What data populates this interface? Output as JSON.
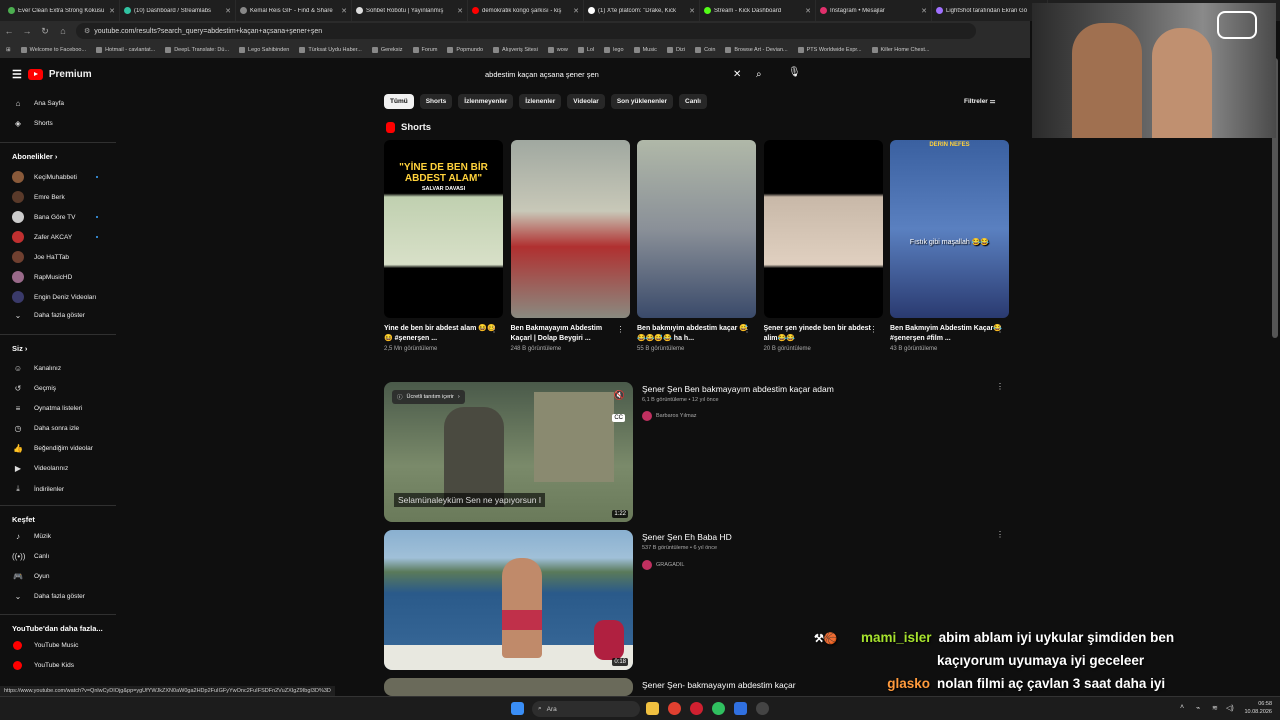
{
  "browser": {
    "tabs": [
      {
        "label": "Ever Clean Extra Strong Kokusu",
        "color": "#4caf50"
      },
      {
        "label": "(10) Dashboard / Streamlabs",
        "color": "#31c3a2"
      },
      {
        "label": "Kemal Reis GIF - Find & Share",
        "color": "#888888"
      },
      {
        "label": "Sohbet Robotu | Yayınlanmış",
        "color": "#dddddd"
      },
      {
        "label": "demokratik kongo şarkısı - kiş",
        "color": "#ff0000"
      },
      {
        "label": "(1) X'te platcom: \"Drake, Kick",
        "color": "#ffffff"
      },
      {
        "label": "Stream - Kick Dashboard",
        "color": "#53fc18"
      },
      {
        "label": "Instagram • Mesajlar",
        "color": "#e1306c"
      },
      {
        "label": "LightShot tarafından Ekran Gö",
        "color": "#a070ff"
      }
    ],
    "url": "youtube.com/results?search_query=abdestim+kaçan+açsana+şener+şen",
    "bookmarks": [
      "Welcome to Faceboo...",
      "Hotmail - cavlantat...",
      "DeepL Translate: Dü...",
      "Lego Sahibinden",
      "Türksat Uydu Haber...",
      "Gereksiz",
      "Forum",
      "Popmundo",
      "Alışveriş Sitesi",
      "wow",
      "Lol",
      "lego",
      "Music",
      "Dizi",
      "Coin",
      "Browse Art - Devian...",
      "PTS Worldwide Expr...",
      "Killer Home Chest..."
    ],
    "status_url": "https://www.youtube.com/watch?v=QnlwCyDIOjg&pp=ygUfYWJkZXN0aW0ga2HDp2FuIGFyYwOnc2FuIFSDFn2VuZXIgZ9IbgI3D%3D"
  },
  "sidebar": {
    "brand": "Premium",
    "main": [
      {
        "label": "Ana Sayfa",
        "icon": "home-icon",
        "glyph": "⌂"
      },
      {
        "label": "Shorts",
        "icon": "shorts-icon",
        "glyph": "◈"
      }
    ],
    "subs_header": "Abonelikler",
    "subs": [
      {
        "label": "KeçiMuhabbeti",
        "color": "#8a5a3a",
        "dot": true
      },
      {
        "label": "Emre Berk",
        "color": "#5a3a2a",
        "dot": false
      },
      {
        "label": "Bana Göre TV",
        "color": "#cccccc",
        "dot": true
      },
      {
        "label": "Zafer AKCAY",
        "color": "#c03030",
        "dot": true
      },
      {
        "label": "Joe HaTTab",
        "color": "#704030",
        "dot": false
      },
      {
        "label": "RapMusicHD",
        "color": "#9a6a8a",
        "dot": false
      },
      {
        "label": "Engin Deniz Videoları",
        "color": "#3a3a6a",
        "dot": false
      }
    ],
    "show_more": "Daha fazla göster",
    "you_header": "Siz",
    "you": [
      {
        "label": "Kanalınız",
        "icon": "channel-icon",
        "glyph": "☺"
      },
      {
        "label": "Geçmiş",
        "icon": "history-icon",
        "glyph": "↺"
      },
      {
        "label": "Oynatma listeleri",
        "icon": "playlist-icon",
        "glyph": "≡"
      },
      {
        "label": "Daha sonra izle",
        "icon": "clock-icon",
        "glyph": "◷"
      },
      {
        "label": "Beğendiğim videolar",
        "icon": "thumbs-up-icon",
        "glyph": "👍"
      },
      {
        "label": "Videolarınız",
        "icon": "video-icon",
        "glyph": "▶"
      },
      {
        "label": "İndirilenler",
        "icon": "download-icon",
        "glyph": "⤓"
      }
    ],
    "explore_header": "Keşfet",
    "explore": [
      {
        "label": "Müzik",
        "icon": "music-icon",
        "glyph": "♪"
      },
      {
        "label": "Canlı",
        "icon": "live-icon",
        "glyph": "((•))"
      },
      {
        "label": "Oyun",
        "icon": "gaming-icon",
        "glyph": "🎮"
      }
    ],
    "explore_more": "Daha fazla göster",
    "more_header": "YouTube'dan daha fazla...",
    "more": [
      {
        "label": "YouTube Music",
        "color": "#ff0000"
      },
      {
        "label": "YouTube Kids",
        "color": "#ff0000"
      }
    ]
  },
  "search": {
    "query": "abdestim kaçan açsana şener şen"
  },
  "chips": [
    "Tümü",
    "Shorts",
    "İzlenmeyenler",
    "İzlenenler",
    "Videolar",
    "Son yüklenenler",
    "Canlı"
  ],
  "filters_label": "Filtreler",
  "shorts_header": "Shorts",
  "shorts": [
    {
      "title": "Yine de ben bir abdest alam 😆🥴😆 #şenerşen ...",
      "views": "2,5 Mn görüntüleme",
      "overlay": "\"YİNE DE BEN BİR ABDEST ALAM\"",
      "sub": "SALVAR DAVASI"
    },
    {
      "title": "Ben Bakmayayım Abdestim Kaçarl | Dolap Beygiri ...",
      "views": "248 B görüntüleme",
      "overlay": "",
      "sub": ""
    },
    {
      "title": "Ben bakmıyim abdestim kaçar 😅😂😂😅😂 ha h...",
      "views": "55 B görüntüleme",
      "overlay": "",
      "sub": ""
    },
    {
      "title": "Şener şen yinede ben bir abdest alim😂😂",
      "views": "20 B görüntüleme",
      "overlay": "",
      "sub": ""
    },
    {
      "title": "Ben Bakmıyim Abdestim Kaçar😂#şenerşen #film ...",
      "views": "43 B görüntüleme",
      "overlay": "Fıstık gibi maşallah 😂😂",
      "sub": "DERIN NEFES"
    }
  ],
  "videos": [
    {
      "title": "Şener Şen Ben bakmayayım abdestim kaçar adam",
      "meta": "6,1 B görüntüleme • 12 yıl önce",
      "channel": "Barbaros Yılmaz",
      "duration": "1:22",
      "chip": "Ücretli tanıtım içerir",
      "subtitle": "Selamünaleyküm Sen ne yapıyorsun I"
    },
    {
      "title": "Şener Şen Eh Baba HD",
      "meta": "537 B görüntüleme • 6 yıl önce",
      "channel": "GRAGADIL",
      "duration": "0:18"
    },
    {
      "title": "Şener Şen- bakmayayım abdestim kaçar",
      "meta": "",
      "channel": "",
      "duration": ""
    }
  ],
  "chat": [
    {
      "user": "mami_isler",
      "msg": "abim ablam iyi uykular şimdiden ben",
      "user_color": "#a6e22e"
    },
    {
      "user": "",
      "msg": "kaçıyorum uyumaya iyi geceleer",
      "user_color": "#a6e22e"
    },
    {
      "user": "glasko",
      "msg": "nolan filmi aç çavlan 3 saat daha iyi",
      "user_color": "#ff9a3c"
    }
  ],
  "taskbar": {
    "search": "Ara",
    "time": "06:58",
    "date": "10.08.2026"
  }
}
